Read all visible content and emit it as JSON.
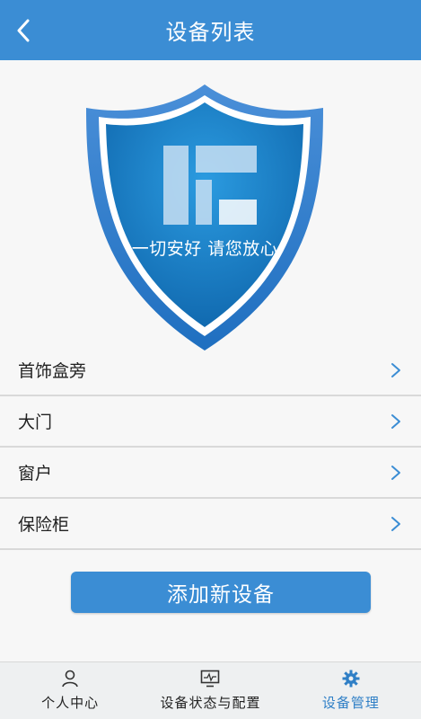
{
  "header": {
    "title": "设备列表",
    "back_icon": "chevron-left-icon"
  },
  "shield": {
    "slogan": "一切安好 请您放心",
    "logo_icon": "brand-logo-icon"
  },
  "devices": [
    {
      "label": "首饰盒旁"
    },
    {
      "label": "大门"
    },
    {
      "label": "窗户"
    },
    {
      "label": "保险柜"
    }
  ],
  "add_button": {
    "label": "添加新设备"
  },
  "tabs": [
    {
      "label": "个人中心",
      "icon": "person-icon",
      "active": false
    },
    {
      "label": "设备状态与配置",
      "icon": "monitor-icon",
      "active": false
    },
    {
      "label": "设备管理",
      "icon": "gear-icon",
      "active": true
    }
  ],
  "colors": {
    "primary": "#3b8dd4",
    "active_tab": "#2f7fc6",
    "background": "#f7f7f7"
  }
}
